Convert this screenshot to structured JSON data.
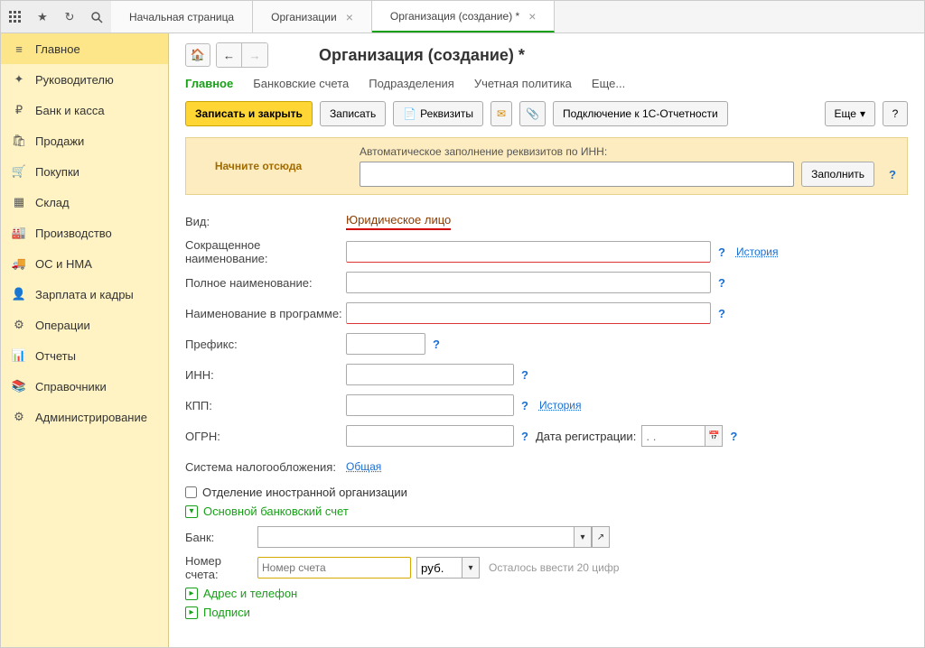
{
  "tabs": {
    "home": "Начальная страница",
    "orgs": "Организации",
    "orgnew": "Организация (создание) *"
  },
  "sidebar": {
    "items": [
      "Главное",
      "Руководителю",
      "Банк и касса",
      "Продажи",
      "Покупки",
      "Склад",
      "Производство",
      "ОС и НМА",
      "Зарплата и кадры",
      "Операции",
      "Отчеты",
      "Справочники",
      "Администрирование"
    ]
  },
  "page": {
    "title": "Организация (создание) *"
  },
  "subtabs": {
    "main": "Главное",
    "bank": "Банковские счета",
    "dep": "Подразделения",
    "pol": "Учетная политика",
    "more": "Еще..."
  },
  "toolbar": {
    "saveclose": "Записать и закрыть",
    "save": "Записать",
    "req": "Реквизиты",
    "connect": "Подключение к 1С-Отчетности",
    "more": "Еще",
    "help": "?"
  },
  "start": {
    "here": "Начните отсюда",
    "label": "Автоматическое заполнение реквизитов по ИНН:",
    "fill": "Заполнить"
  },
  "form": {
    "vid_label": "Вид:",
    "vid_value": "Юридическое лицо",
    "short_label": "Сокращенное наименование:",
    "history": "История",
    "full_label": "Полное наименование:",
    "prog_label": "Наименование в программе:",
    "prefix_label": "Префикс:",
    "inn_label": "ИНН:",
    "kpp_label": "КПП:",
    "kpp_history": "История",
    "ogrn_label": "ОГРН:",
    "regdate_label": "Дата регистрации:",
    "regdate_ph": ". .",
    "tax_label": "Система налогообложения:",
    "tax_value": "Общая",
    "foreign": "Отделение иностранной организации",
    "bank_section": "Основной банковский счет",
    "bank_label": "Банк:",
    "acct_label": "Номер счета:",
    "acct_ph": "Номер счета",
    "curr": "руб.",
    "left": "Осталось ввести 20 цифр",
    "addr_section": "Адрес и телефон",
    "sign_section": "Подписи"
  }
}
